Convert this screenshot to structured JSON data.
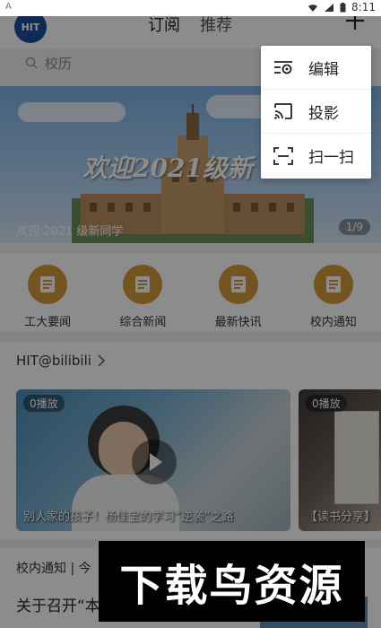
{
  "status": {
    "left": "A",
    "time": "8:11"
  },
  "header": {
    "logo": "HIT",
    "tabs": [
      {
        "label": "订阅"
      },
      {
        "label": "推荐"
      }
    ]
  },
  "search": {
    "placeholder": "校历"
  },
  "banner": {
    "title": "欢迎2021级新",
    "caption": "欢迎 2021 级新同学",
    "page": "1/9"
  },
  "quicknav": [
    {
      "label": "工大要闻"
    },
    {
      "label": "综合新闻"
    },
    {
      "label": "最新快讯"
    },
    {
      "label": "校内通知"
    }
  ],
  "bili": {
    "title": "HIT@bilibili",
    "cards": [
      {
        "plays": "0播放",
        "caption": "别人家的孩子！杨佳宝的学习“逆袭”之路"
      },
      {
        "plays": "0播放",
        "caption": "【读书分享】"
      }
    ]
  },
  "notice": {
    "head": "校内通知 | 今",
    "text": "关于召开“本 研讨会”的通知"
  },
  "menu": [
    {
      "label": "编辑",
      "icon": "edit-icon"
    },
    {
      "label": "投影",
      "icon": "cast-icon"
    },
    {
      "label": "扫一扫",
      "icon": "scan-icon"
    }
  ],
  "watermark": "下载鸟资源",
  "colors": {
    "accent": "#d39a3a",
    "logo": "#1d4f9c"
  }
}
